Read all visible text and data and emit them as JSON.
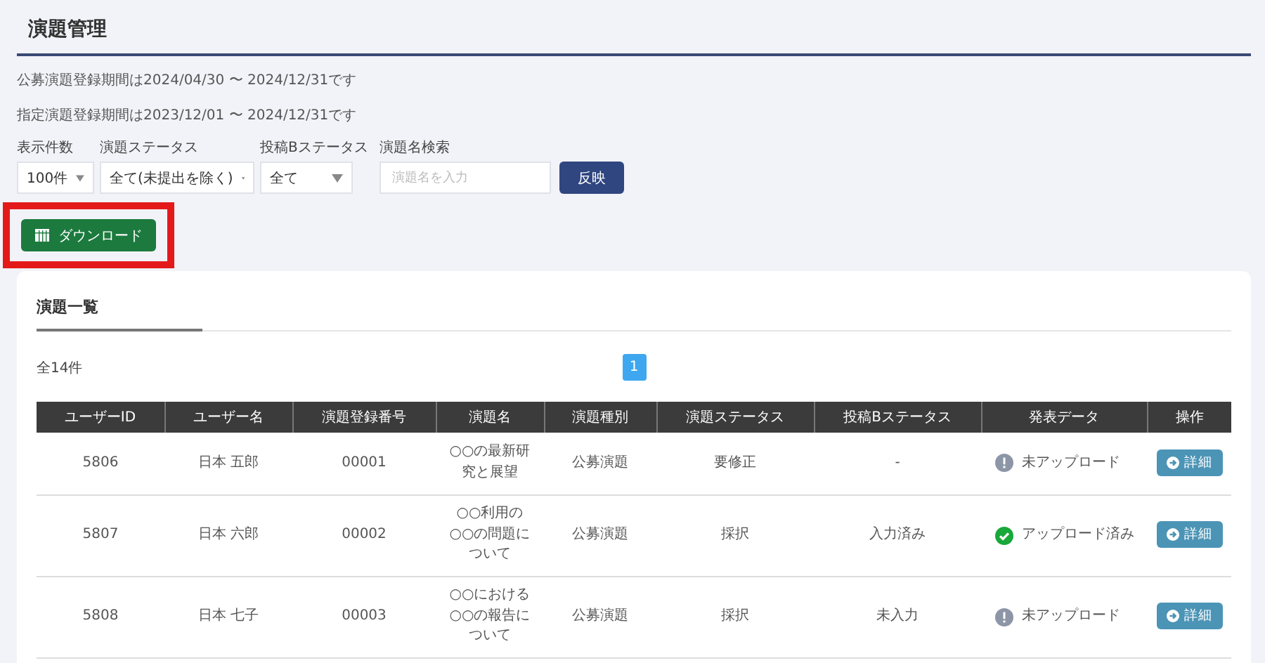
{
  "page_title": "演題管理",
  "notices": [
    "公募演題登録期間は2024/04/30 〜 2024/12/31です",
    "指定演題登録期間は2023/12/01 〜 2024/12/31です"
  ],
  "filters": [
    {
      "kind": "select",
      "label": "表示件数",
      "value": "100件"
    },
    {
      "kind": "select",
      "label": "演題ステータス",
      "value": "全て(未提出を除く)"
    },
    {
      "kind": "select",
      "label": "投稿Bステータス",
      "value": "全て"
    },
    {
      "kind": "input",
      "label": "演題名検索",
      "placeholder": "演題名を入力"
    }
  ],
  "apply_button": "反映",
  "download_button": {
    "label": "ダウンロード",
    "highlighted": true
  },
  "list": {
    "title": "演題一覧",
    "count": "全14件",
    "pages": [
      {
        "label": "1",
        "selected": true
      }
    ],
    "columns": [
      "ユーザーID",
      "ユーザー名",
      "演題登録番号",
      "演題名",
      "演題種別",
      "演題ステータス",
      "投稿Bステータス",
      "発表データ",
      "操作"
    ],
    "rows": [
      {
        "user_id": "5806",
        "user_name": "日本 五郎",
        "number": "00001",
        "title": "○○の最新研究と展望",
        "type": "公募演題",
        "status": "要修正",
        "b_status": "-",
        "upload": {
          "uploaded": false,
          "label": "未アップロード"
        },
        "action": "詳細"
      },
      {
        "user_id": "5807",
        "user_name": "日本 六郎",
        "number": "00002",
        "title": "○○利用の○○の問題について",
        "type": "公募演題",
        "status": "採択",
        "b_status": "入力済み",
        "upload": {
          "uploaded": true,
          "label": "アップロード済み"
        },
        "action": "詳細"
      },
      {
        "user_id": "5808",
        "user_name": "日本 七子",
        "number": "00003",
        "title": "○○における○○の報告について",
        "type": "公募演題",
        "status": "採択",
        "b_status": "未入力",
        "upload": {
          "uploaded": false,
          "label": "未アップロード"
        },
        "action": "詳細"
      }
    ]
  }
}
